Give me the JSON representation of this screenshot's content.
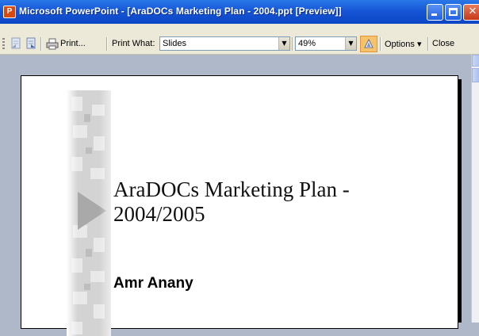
{
  "window": {
    "title": "Microsoft PowerPoint - [AraDOCs Marketing Plan - 2004.ppt [Preview]]",
    "app_icon_glyph": "P",
    "controls": {
      "minimize_icon": "minimize-icon",
      "maximize_icon": "maximize-icon",
      "close_glyph": "✕"
    }
  },
  "toolbar": {
    "print_label": "Print...",
    "print_what_label": "Print What:",
    "print_what_value": "Slides",
    "zoom_value": "49%",
    "options_label": "Options",
    "options_arrow": "▾",
    "close_label": "Close",
    "combo_arrow": "▼"
  },
  "slide": {
    "title_line1": "AraDOCs Marketing Plan -",
    "title_line2": "2004/2005",
    "author": "Amr Anany"
  },
  "colors": {
    "titlebar": "#0b45c4",
    "toolbar": "#ece9d8",
    "workspace": "#aeb8c8",
    "toggle_active": "#f4c36a"
  }
}
